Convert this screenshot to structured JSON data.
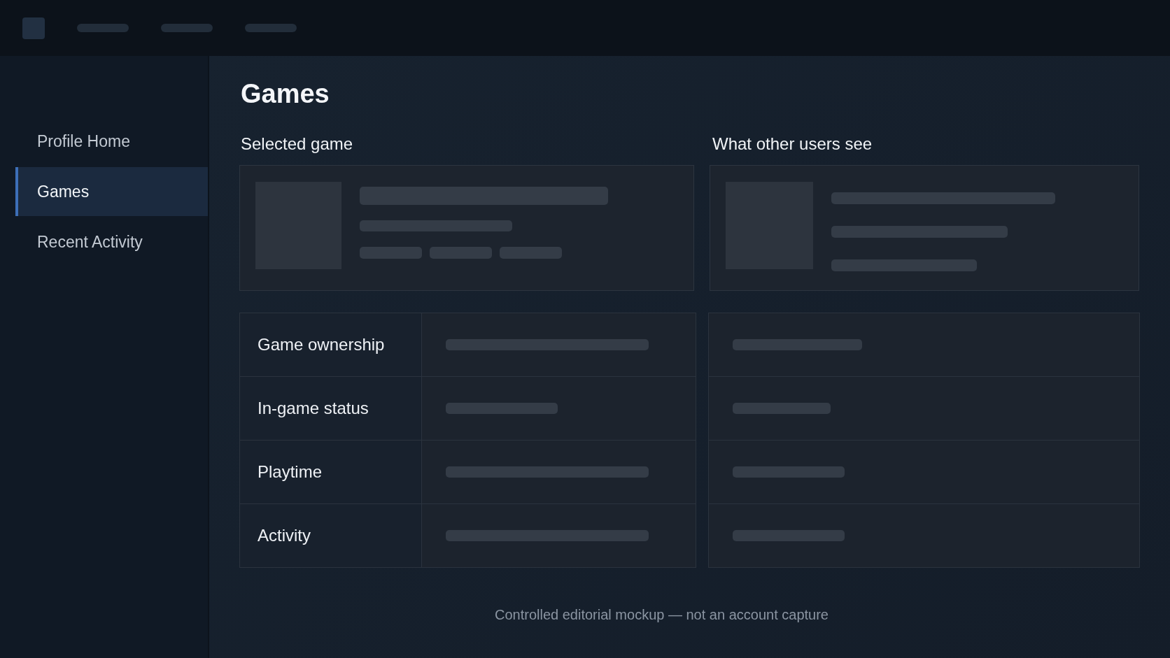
{
  "sidebar": {
    "items": [
      {
        "label": "Profile Home",
        "selected": false
      },
      {
        "label": "Games",
        "selected": true
      },
      {
        "label": "Recent Activity",
        "selected": false
      }
    ]
  },
  "title": "Games",
  "selected_game": {
    "heading": "Selected game"
  },
  "preview": {
    "heading": "What other users see"
  },
  "table": {
    "rows": [
      {
        "label": "Game ownership"
      },
      {
        "label": "In-game status"
      },
      {
        "label": "Playtime"
      },
      {
        "label": "Activity"
      }
    ]
  },
  "footer": "Controlled editorial mockup — not an account capture"
}
